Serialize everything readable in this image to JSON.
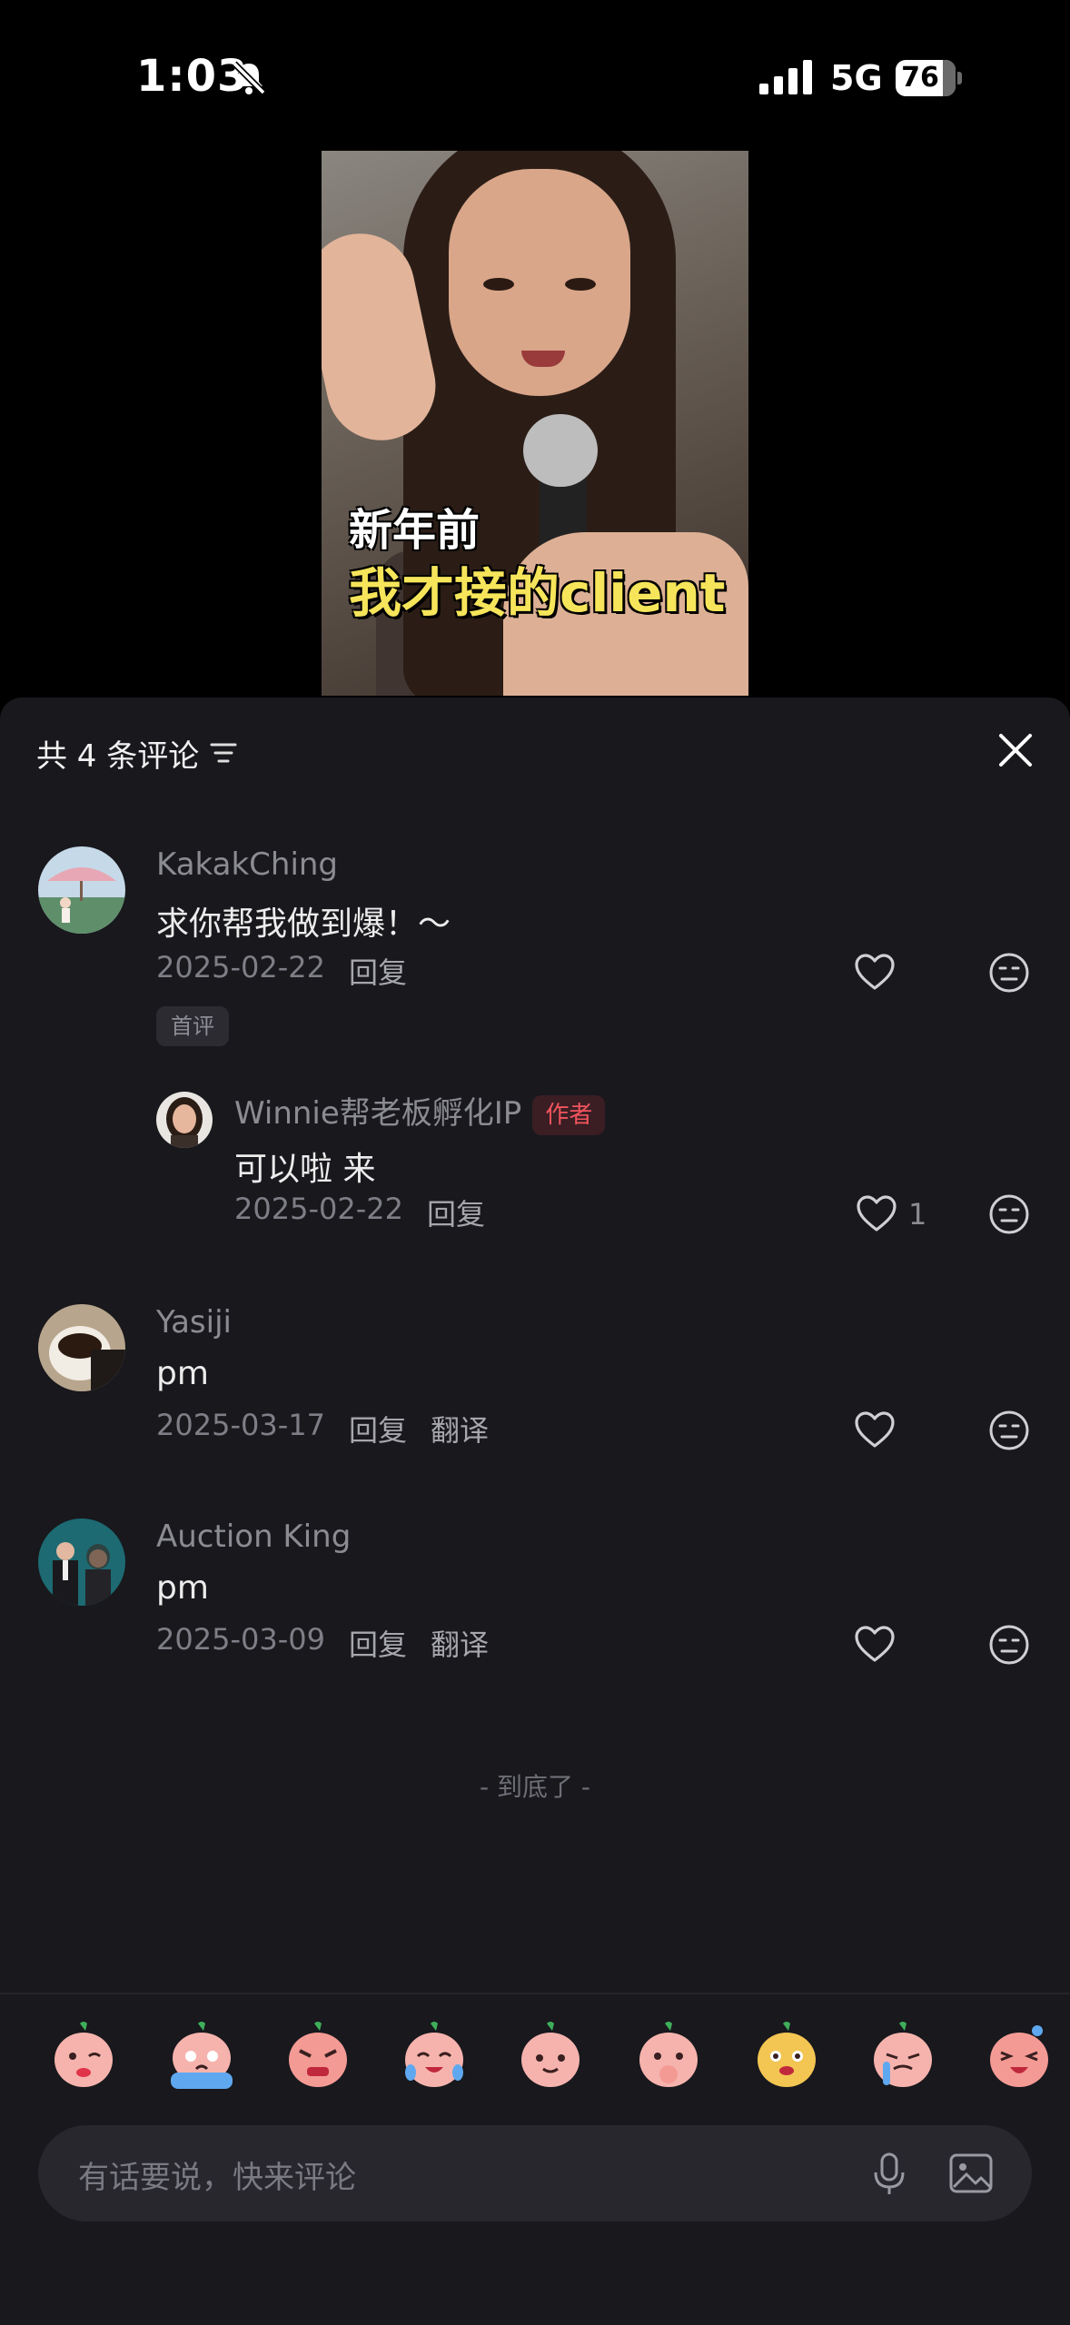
{
  "status_bar": {
    "time": "1:03",
    "network": "5G",
    "battery": "76"
  },
  "video": {
    "caption_line1": "新年前",
    "caption_line2": "我才接的client"
  },
  "comments_panel": {
    "title": "共 4 条评论",
    "comments": [
      {
        "user": "KakakChing",
        "text": "求你帮我做到爆！～",
        "date": "2025-02-22",
        "reply": "回复",
        "tag": "首评",
        "replies": [
          {
            "user": "Winnie帮老板孵化IP",
            "badge": "作者",
            "text": "可以啦 来",
            "date": "2025-02-22",
            "reply": "回复",
            "likes": "1"
          }
        ]
      },
      {
        "user": "Yasiji",
        "text": "pm",
        "date": "2025-03-17",
        "reply": "回复",
        "translate": "翻译"
      },
      {
        "user": "Auction King",
        "text": "pm",
        "date": "2025-03-09",
        "reply": "回复",
        "translate": "翻译"
      }
    ],
    "end_text": "- 到底了 -"
  },
  "emoji_bar": {
    "items": [
      "blush-emoji",
      "crying-emoji",
      "angry-emoji",
      "tears-emoji",
      "smile-emoji",
      "shy-emoji",
      "dog-emoji",
      "sob-emoji",
      "laugh-emoji"
    ]
  },
  "input": {
    "placeholder": "有话要说，快来评论"
  },
  "colors": {
    "panel_bg": "#18181d",
    "author_badge": "#f2545d",
    "caption_yellow": "#f6e55a"
  }
}
